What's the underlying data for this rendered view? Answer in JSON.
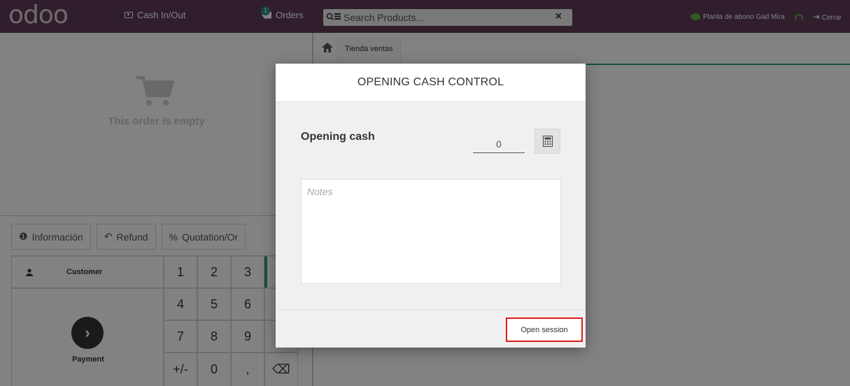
{
  "topbar": {
    "logo": "odoo",
    "cash_in_out_label": "Cash In/Out",
    "orders_label": "Orders",
    "orders_count": "1",
    "search": {
      "placeholder": "Search Products..."
    },
    "shop_name": "Planta de abono Gad Mira",
    "logout_label": "Cerrar"
  },
  "left": {
    "empty_order_text": "This order is empty",
    "control_buttons": {
      "info_label": "Información",
      "refund_label": "Refund",
      "quotation_label": "Quotation/Or"
    },
    "customer_label": "Customer",
    "payment_label": "Payment",
    "numpad": [
      "1",
      "2",
      "3",
      "",
      "4",
      "5",
      "6",
      "",
      "7",
      "8",
      "9",
      "",
      "+/-",
      "0",
      ",",
      "⌫"
    ]
  },
  "right": {
    "breadcrumb": "Tienda ventas"
  },
  "modal": {
    "title": "OPENING CASH CONTROL",
    "opening_cash_label": "Opening cash",
    "opening_cash_value": "0",
    "notes_placeholder": "Notes",
    "open_session_label": "Open session"
  },
  "colors": {
    "topbar": "#5e3b58",
    "accent_green": "#2e9f64",
    "highlight_red": "#e11b1b"
  }
}
